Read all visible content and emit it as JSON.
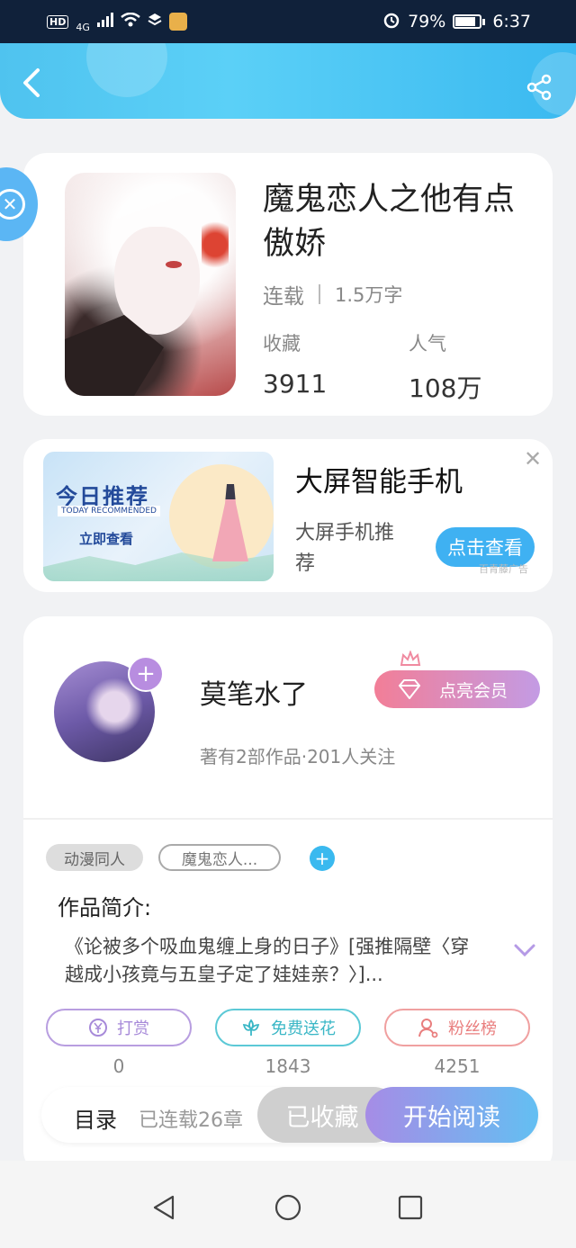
{
  "status_bar": {
    "hd": "HD",
    "network": "4G",
    "battery_percent": "79%",
    "time": "6:37",
    "icons": [
      "signal-icon",
      "wifi-icon",
      "layers-icon",
      "app-notification-icon",
      "alarm-icon",
      "battery-charging-icon"
    ]
  },
  "header": {
    "back_icon": "chevron-left-icon",
    "share_icon": "share-icon",
    "gradient_colors": [
      "#4fc3ef",
      "#3ab9f0"
    ]
  },
  "book": {
    "title": "魔鬼恋人之他有点傲娇",
    "status": "连载",
    "word_count": "1.5万字",
    "favorites_label": "收藏",
    "favorites_value": "3911",
    "popularity_label": "人气",
    "popularity_value": "108万"
  },
  "ad": {
    "banner_heading": "今日推荐",
    "banner_subheading": "TODAY RECOMMENDED",
    "banner_cta": "立即查看",
    "title": "大屏智能手机",
    "subtitle": "大屏手机推荐",
    "button": "点击查看",
    "source": "百青藤广告",
    "close_icon": "close-icon"
  },
  "author": {
    "name": "莫笔水了",
    "info": "著有2部作品·201人关注",
    "vip_button": "点亮会员",
    "follow_icon": "plus-icon"
  },
  "tags": {
    "items": [
      "动漫同人",
      "魔鬼恋人..."
    ],
    "add_icon": "plus-icon"
  },
  "intro": {
    "title": "作品简介:",
    "text": "《论被多个吸血鬼缠上身的日子》[强推隔壁〈穿越成小孩竟与五皇子定了娃娃亲？〉]..."
  },
  "actions": {
    "reward": {
      "label": "打赏",
      "count": "0",
      "icon": "yen-coin-icon"
    },
    "flower": {
      "label": "免费送花",
      "count": "1843",
      "icon": "flower-icon"
    },
    "fans": {
      "label": "粉丝榜",
      "count": "4251",
      "icon": "user-icon"
    }
  },
  "reading_bar": {
    "toc": "目录",
    "chapters": "已连载26章",
    "favorited": "已收藏",
    "start_reading": "开始阅读"
  },
  "nav": {
    "back_icon": "nav-back-triangle-icon",
    "home_icon": "nav-home-circle-icon",
    "recents_icon": "nav-recents-square-icon"
  }
}
